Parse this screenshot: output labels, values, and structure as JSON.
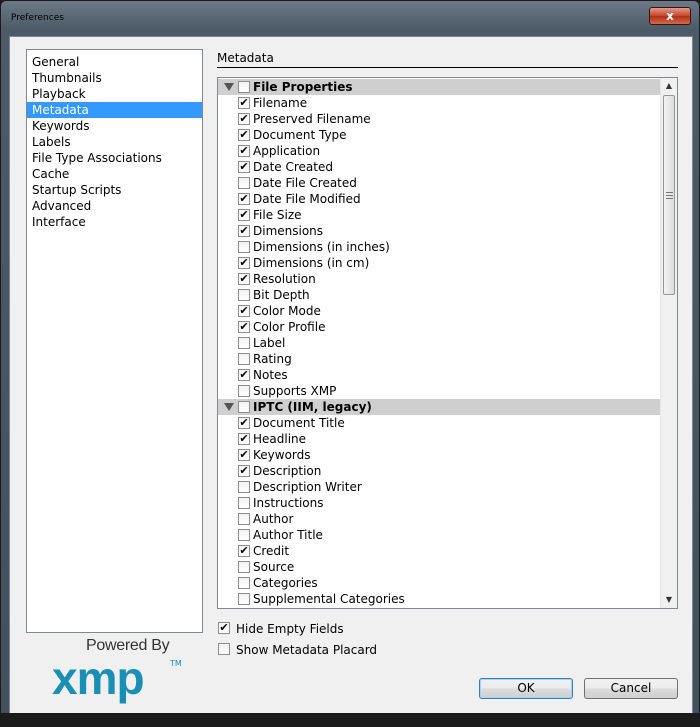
{
  "window": {
    "title": "Preferences",
    "close_glyph": "x"
  },
  "sidebar": {
    "items": [
      {
        "label": "General"
      },
      {
        "label": "Thumbnails"
      },
      {
        "label": "Playback"
      },
      {
        "label": "Metadata",
        "selected": true
      },
      {
        "label": "Keywords"
      },
      {
        "label": "Labels"
      },
      {
        "label": "File Type Associations"
      },
      {
        "label": "Cache"
      },
      {
        "label": "Startup Scripts"
      },
      {
        "label": "Advanced"
      },
      {
        "label": "Interface"
      }
    ]
  },
  "logo": {
    "powered_by": "Powered By",
    "brand": "xmp",
    "tm": "TM"
  },
  "main": {
    "section_title": "Metadata",
    "rows": [
      {
        "label": "File Properties",
        "header": true,
        "checked": false
      },
      {
        "label": "Filename",
        "checked": true
      },
      {
        "label": "Preserved Filename",
        "checked": true
      },
      {
        "label": "Document Type",
        "checked": true
      },
      {
        "label": "Application",
        "checked": true
      },
      {
        "label": "Date Created",
        "checked": true
      },
      {
        "label": "Date File Created",
        "checked": false
      },
      {
        "label": "Date File Modified",
        "checked": true
      },
      {
        "label": "File Size",
        "checked": true
      },
      {
        "label": "Dimensions",
        "checked": true
      },
      {
        "label": "Dimensions (in inches)",
        "checked": false
      },
      {
        "label": "Dimensions (in cm)",
        "checked": true
      },
      {
        "label": "Resolution",
        "checked": true
      },
      {
        "label": "Bit Depth",
        "checked": false
      },
      {
        "label": "Color Mode",
        "checked": true
      },
      {
        "label": "Color Profile",
        "checked": true
      },
      {
        "label": "Label",
        "checked": false
      },
      {
        "label": "Rating",
        "checked": false
      },
      {
        "label": "Notes",
        "checked": true
      },
      {
        "label": "Supports XMP",
        "checked": false
      },
      {
        "label": "IPTC (IIM, legacy)",
        "header": true,
        "checked": false
      },
      {
        "label": "Document Title",
        "checked": true
      },
      {
        "label": "Headline",
        "checked": true
      },
      {
        "label": "Keywords",
        "checked": true
      },
      {
        "label": "Description",
        "checked": true
      },
      {
        "label": "Description Writer",
        "checked": false
      },
      {
        "label": "Instructions",
        "checked": false
      },
      {
        "label": "Author",
        "checked": false
      },
      {
        "label": "Author Title",
        "checked": false
      },
      {
        "label": "Credit",
        "checked": true
      },
      {
        "label": "Source",
        "checked": false
      },
      {
        "label": "Categories",
        "checked": false
      },
      {
        "label": "Supplemental Categories",
        "checked": false
      }
    ]
  },
  "options": {
    "hide_empty_fields": {
      "label": "Hide Empty Fields",
      "checked": true
    },
    "show_metadata_placard": {
      "label": "Show Metadata Placard",
      "checked": false
    }
  },
  "buttons": {
    "ok": "OK",
    "cancel": "Cancel"
  },
  "icons": {
    "check": "✔",
    "expand": "triangle-down-icon",
    "scroll_up": "▲",
    "scroll_down": "▼"
  },
  "colors": {
    "selection": "#3399ff",
    "brand": "#1a8fb5",
    "close": "#c4452c"
  }
}
